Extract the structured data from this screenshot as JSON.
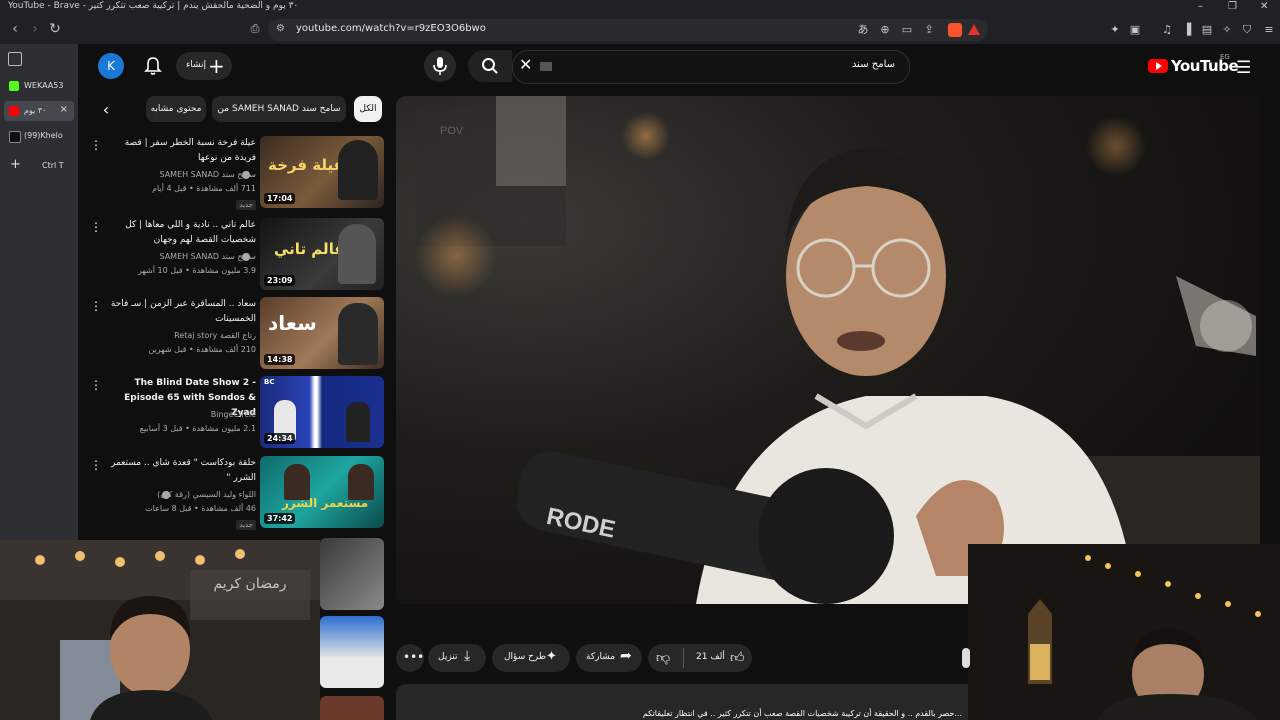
{
  "window": {
    "title": "YouTube - Brave - ٣٠ يوم و الضحية مالحقش يندم | تركيبة صعب تتكرر كتير",
    "controls": [
      "–",
      "❐",
      "✕"
    ]
  },
  "address": {
    "url": "youtube.com/watch?v=r9zEO3O6bwo"
  },
  "browser_sidebar": {
    "tabs": [
      {
        "label": "WEKAA53",
        "icon": "kick-icon",
        "color": "#53fc18"
      },
      {
        "label": "٣٠ يوم",
        "icon": "youtube-icon",
        "color": "#ff0000"
      },
      {
        "label": "(99)Khelo",
        "icon": "tiktok-icon",
        "color": "#111111"
      }
    ],
    "new_tab_label": "Ctrl T"
  },
  "youtube_header": {
    "logo": "YouTube",
    "country": "EG",
    "search_value": "سامح سند",
    "create_label": "إنشاء",
    "avatar_letter": "K"
  },
  "chips": [
    {
      "label": "الكل",
      "active": true
    },
    {
      "label": "من SAMEH SANAD سامح سند",
      "active": false
    },
    {
      "label": "محتوى مشابه",
      "active": false
    }
  ],
  "recommendations": [
    {
      "title": "عيلة فرخة نسبة الخطر سفر | قصة فريدة من نوعها",
      "channel": "سامح سند SAMEH SANAD",
      "verified": true,
      "meta": "711 ألف مشاهدة • قبل 4 أيام",
      "badge": "جديد",
      "duration": "17:04",
      "thumb_text": "عيلة فرخة"
    },
    {
      "title": "عالم تاني .. نادية و اللي معاها | كل شخصيات القصة لهم وجهان",
      "channel": "سامح سند SAMEH SANAD",
      "verified": true,
      "meta": "3.9 مليون مشاهدة • قبل 10 أشهر",
      "badge": "",
      "duration": "23:09",
      "thumb_text": "عالم تاني"
    },
    {
      "title": "سعاد .. المسافرة عبر الزمن | سـ فاحة الخمسينات",
      "channel": "رتاج القصة Retaj story",
      "verified": false,
      "meta": "210 ألف مشاهدة • قبل شهرين",
      "badge": "",
      "duration": "14:38",
      "thumb_text": "سعاد"
    },
    {
      "title": "The Blind Date Show 2 - Episode 65 with Sondos & Zyad",
      "channel": "BingeCircle",
      "verified": false,
      "meta": "2.1 مليون مشاهدة • قبل 3 أسابيع",
      "badge": "",
      "duration": "24:34",
      "thumb_text": "BC"
    },
    {
      "title": "حلقة بودكاست \" قعدة شاي .. مستعمر الشرر \"",
      "channel": "اللواء وليد السيسي (رقة كان)",
      "verified": true,
      "meta": "46 ألف مشاهدة • قبل 8 ساعات",
      "badge": "جديد",
      "duration": "37:42",
      "thumb_text": "مستعمر الشرر"
    }
  ],
  "actions": {
    "likes": "21 ألف",
    "share": "مشاركة",
    "ask": "طرح سؤال",
    "download": "تنزيل"
  },
  "description": {
    "text": "...حصر بالقدم .. و الحقيقة أن تركيبة شخصيات القصة صعب أن تتكرر كثير .. في انتظار تعليقاتكم"
  },
  "webcam_left": {
    "sign": "رمضان كريم"
  },
  "video": {
    "mic_brand": "RODE",
    "watermark": "POV"
  }
}
